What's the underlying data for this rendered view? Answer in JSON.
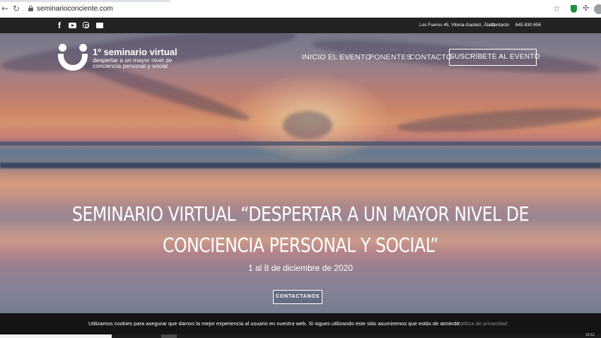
{
  "browser": {
    "url": "seminarioconciente.com",
    "icons": {
      "back": "arrow-left-icon",
      "reload": "reload-icon",
      "lock": "lock-icon",
      "bookmark": "star-icon",
      "extension": "puzzle-icon"
    }
  },
  "topbar": {
    "address": "Los Fueros 45, Vitoria-Gasteiz, Álava",
    "contact_label": "Contacto",
    "phone": "645 830 656",
    "social_icons": [
      "facebook-icon",
      "youtube-icon",
      "instagram-icon",
      "mail-icon"
    ],
    "fb_glyph": "f"
  },
  "logo": {
    "title": "1º seminario virtual",
    "subtitle_line1": "despertar a un mayor nivel de",
    "subtitle_line2": "conciencia personal y social"
  },
  "nav": {
    "items": [
      {
        "label": "INICIO"
      },
      {
        "label": "EL EVENTO"
      },
      {
        "label": "PONENTES"
      },
      {
        "label": "CONTACTO"
      }
    ],
    "subscribe_label": "SUSCRÍBETE AL EVENTO"
  },
  "hero": {
    "title_line1": "SEMINARIO VIRTUAL “DESPERTAR A UN MAYOR NIVEL DE",
    "title_line2": "CONCIENCIA PERSONAL Y SOCIAL”",
    "date": "1 al 8 de diciembre de 2020",
    "cta_label": "CONTACTANOS"
  },
  "cookie": {
    "text": "Utilizamos cookies para asegurar que damos la mejor experiencia al usuario en nuestra web. Si sigues utilizando este sitio asumiremos que estás de acuerdo.",
    "accept_label": "Vale",
    "policy_label": "Política de privacidad"
  },
  "taskbar": {
    "clock": "13:12"
  },
  "colors": {
    "topbar_bg": "#232323",
    "cookie_bg": "#141414",
    "muted_link": "#8a8a8a"
  }
}
